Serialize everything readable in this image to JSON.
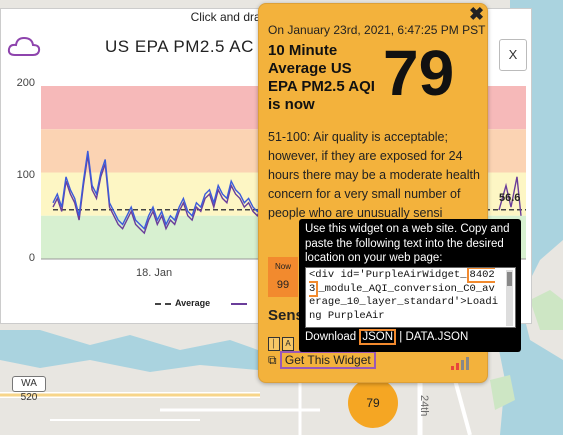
{
  "map": {
    "road_wa520": "WA 520",
    "road_24th": "24th",
    "marker_value": "79"
  },
  "chart_panel": {
    "zoom_hint": "Click and drag to zoom in. H",
    "title": "US EPA PM2.5 AC",
    "close_label": "X",
    "y_ticks": [
      "200",
      "100",
      "0"
    ],
    "x_tick": "18. Jan",
    "legend_average": "Average",
    "end_value_label": "56.6"
  },
  "chart_data": {
    "type": "line",
    "title": "US EPA PM2.5 AC",
    "ylim": [
      0,
      200
    ],
    "bands": [
      {
        "from": 150,
        "to": 200,
        "color": "#f6b9b9"
      },
      {
        "from": 100,
        "to": 150,
        "color": "#fbd3b3"
      },
      {
        "from": 50,
        "to": 100,
        "color": "#fdf6c4"
      },
      {
        "from": 0,
        "to": 50,
        "color": "#d7f0d0"
      }
    ],
    "x_tick_label": "18. Jan",
    "average_value": 57,
    "series": [
      {
        "name": "Average",
        "values": [
          57
        ],
        "style": "dashed",
        "color": "#444444"
      },
      {
        "values": [
          60,
          70,
          55,
          90,
          75,
          65,
          45,
          85,
          120,
          80,
          70,
          95,
          110,
          60,
          50,
          40,
          35,
          45,
          55,
          40,
          35,
          30,
          45,
          55,
          40,
          50,
          35,
          45,
          40,
          55,
          65,
          50,
          45,
          60,
          55,
          70,
          75,
          60,
          80,
          70,
          65,
          85,
          75,
          70,
          60,
          65,
          55,
          50,
          60,
          55
        ],
        "color": "#6a3d9a"
      },
      {
        "values": [
          65,
          75,
          60,
          95,
          80,
          70,
          50,
          90,
          125,
          85,
          75,
          100,
          115,
          65,
          55,
          45,
          40,
          50,
          60,
          45,
          40,
          35,
          50,
          60,
          45,
          55,
          40,
          50,
          45,
          60,
          70,
          55,
          50,
          65,
          60,
          75,
          80,
          65,
          85,
          75,
          70,
          90,
          80,
          75,
          65,
          70,
          60,
          55,
          65,
          60
        ],
        "color": "#3b5bdb"
      }
    ],
    "end_value": 56.6
  },
  "popup": {
    "close_label": "✖",
    "date": "On January 23rd, 2021, 6:47:25 PM PST",
    "label": "10 Minute Average US EPA PM2.5 AQI is now",
    "aqi": "79",
    "description": "51-100: Air quality is acceptable; however, if they are exposed for 24 hours there may be a moderate health concern for a very small number of people who are unusually sensi",
    "now_label": "Now",
    "now_value": "99",
    "sensors_heading": "Sens",
    "sensor_icon_a": "A",
    "get_widget_label": "Get This Widget",
    "colors": {
      "popup_bg": "#f3b23c",
      "now_bg": "#f28a2e"
    }
  },
  "widget": {
    "instructions": "Use this widget on a web site. Copy and paste the following text into the desired location on your web page:",
    "code_before": "<div id='PurpleAirWidget_",
    "code_id": "84023",
    "code_after": "_module_AQI_conversion_C0_average_10_layer_standard'>Loading PurpleAir",
    "download_label": "Download",
    "json_label": "JSON",
    "separator": "|",
    "data_json_label": "DATA.JSON"
  }
}
